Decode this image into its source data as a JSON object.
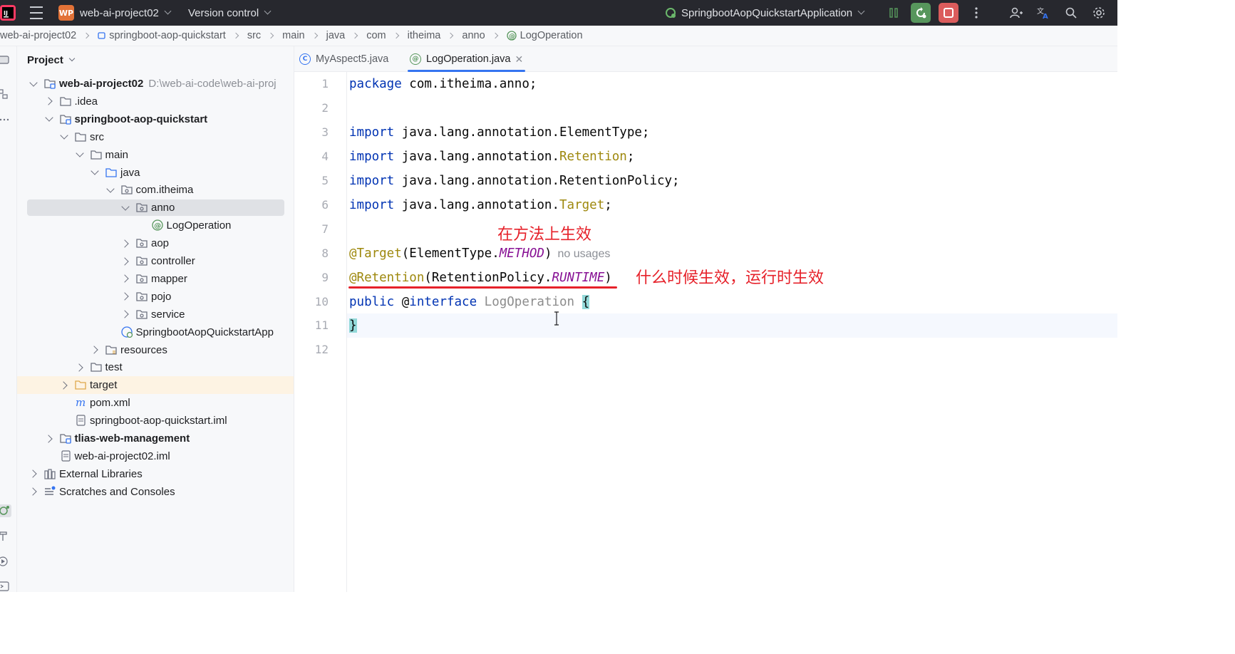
{
  "titlebar": {
    "project_badge": "WP",
    "project_name": "web-ai-project02",
    "vcs_label": "Version control",
    "run_config": "SpringbootAopQuickstartApplication"
  },
  "breadcrumb": [
    "web-ai-project02",
    "springboot-aop-quickstart",
    "src",
    "main",
    "java",
    "com",
    "itheima",
    "anno",
    "LogOperation"
  ],
  "project_panel": {
    "title": "Project",
    "tree": [
      {
        "label": "web-ai-project02",
        "hint": "D:\\web-ai-code\\web-ai-proj",
        "bold": true,
        "icon": "module-folder-icon",
        "arrow": "down"
      },
      {
        "label": ".idea",
        "icon": "folder-icon",
        "arrow": "right"
      },
      {
        "label": "springboot-aop-quickstart",
        "bold": true,
        "icon": "module-folder-icon",
        "arrow": "down"
      },
      {
        "label": "src",
        "icon": "folder-icon",
        "arrow": "down"
      },
      {
        "label": "main",
        "icon": "folder-icon",
        "arrow": "down"
      },
      {
        "label": "java",
        "icon": "source-folder-icon",
        "arrow": "down"
      },
      {
        "label": "com.itheima",
        "icon": "package-icon",
        "arrow": "down"
      },
      {
        "label": "anno",
        "icon": "package-icon",
        "arrow": "down",
        "selected": true
      },
      {
        "label": "LogOperation",
        "icon": "annotation-icon"
      },
      {
        "label": "aop",
        "icon": "package-icon",
        "arrow": "right"
      },
      {
        "label": "controller",
        "icon": "package-icon",
        "arrow": "right"
      },
      {
        "label": "mapper",
        "icon": "package-icon",
        "arrow": "right"
      },
      {
        "label": "pojo",
        "icon": "package-icon",
        "arrow": "right"
      },
      {
        "label": "service",
        "icon": "package-icon",
        "arrow": "right"
      },
      {
        "label": "SpringbootAopQuickstartApp",
        "icon": "spring-class-icon"
      },
      {
        "label": "resources",
        "icon": "resources-folder-icon",
        "arrow": "right"
      },
      {
        "label": "test",
        "icon": "folder-icon",
        "arrow": "right"
      },
      {
        "label": "target",
        "icon": "excluded-folder-icon",
        "arrow": "right",
        "highlight": true
      },
      {
        "label": "pom.xml",
        "icon": "maven-icon"
      },
      {
        "label": "springboot-aop-quickstart.iml",
        "icon": "file-icon"
      },
      {
        "label": "tlias-web-management",
        "bold": true,
        "icon": "module-folder-icon",
        "arrow": "right"
      },
      {
        "label": "web-ai-project02.iml",
        "icon": "file-icon"
      },
      {
        "label": "External Libraries",
        "icon": "library-icon",
        "arrow": "right"
      },
      {
        "label": "Scratches and Consoles",
        "icon": "scratches-icon",
        "arrow": "right"
      }
    ]
  },
  "tabs": [
    {
      "label": "MyAspect5.java",
      "icon": "C"
    },
    {
      "label": "LogOperation.java",
      "icon": "@",
      "active": true
    }
  ],
  "editor": {
    "line_numbers": [
      "1",
      "2",
      "3",
      "4",
      "5",
      "6",
      "7",
      "8",
      "9",
      "10",
      "11",
      "12"
    ],
    "code": {
      "l1_kw": "package",
      "l1_rest": " com.itheima.anno;",
      "l3_kw": "import",
      "l3_rest": " java.lang.annotation.ElementType;",
      "l4_kw": "import",
      "l4_rest": " java.lang.annotation.",
      "l4_ann": "Retention",
      "l4_end": ";",
      "l5_kw": "import",
      "l5_rest": " java.lang.annotation.RetentionPolicy;",
      "l6_kw": "import",
      "l6_rest": " java.lang.annotation.",
      "l6_ann": "Target",
      "l6_end": ";",
      "l8_ann": "@Target",
      "l8_open": "(ElementType.",
      "l8_enum": "METHOD",
      "l8_close": ")",
      "l8_hint": "no usages",
      "l9_ann": "@Retention",
      "l9_open": "(RetentionPolicy.",
      "l9_enum": "RUNTIME",
      "l9_close": ")",
      "l10_kw": "public",
      "l10_at": " @",
      "l10_kw2": "interface",
      "l10_name": " LogOperation ",
      "l10_brace": "{",
      "l11_brace": "}"
    },
    "annotations": {
      "method_note": "在方法上生效",
      "runtime_note": "什么时候生效，运行时生效"
    }
  }
}
